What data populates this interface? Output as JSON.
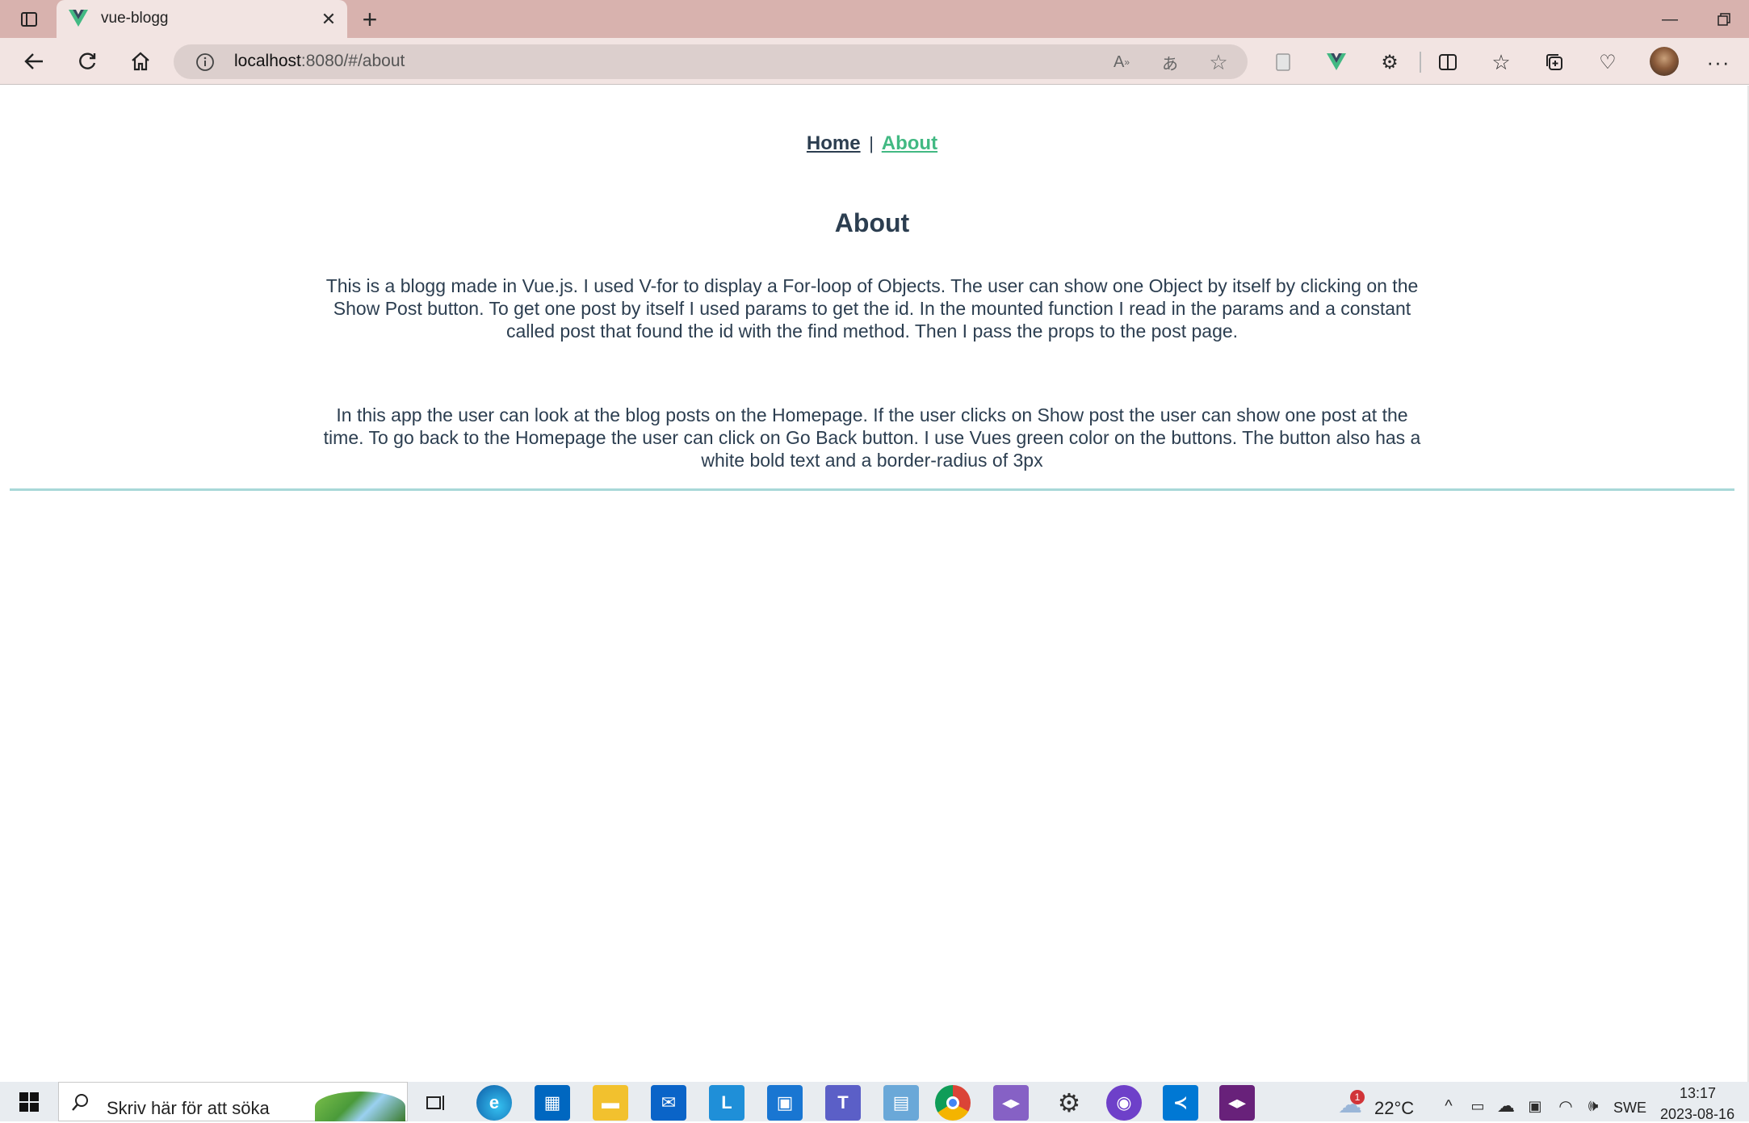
{
  "browser": {
    "tab_title": "vue-blogg",
    "url_host": "localhost",
    "url_path": ":8080/#/about"
  },
  "page": {
    "nav": {
      "home_label": "Home",
      "separator": "|",
      "about_label": "About"
    },
    "heading": "About",
    "paragraph1": "This is a blogg made in Vue.js. I used V-for to display a For-loop of Objects. The user can show one Object by itself by clicking on the Show Post button. To get one post by itself I used params to get the id. In the mounted function I read in the params and a constant called post that found the id with the find method. Then I pass the props to the post page.",
    "paragraph2": "In this app the user can look at the blog posts on the Homepage. If the user clicks on Show post the user can show one post at the time. To go back to the Homepage the user can click on Go Back button. I use Vues green color on the buttons. The button also has a white bold text and a border-radius of 3px"
  },
  "taskbar": {
    "search_placeholder": "Skriv här för att söka",
    "weather_temp": "22°C",
    "weather_badge": "1",
    "language": "SWE",
    "time": "13:17",
    "date": "2023-08-16"
  },
  "colors": {
    "vue_green": "#42b983",
    "text": "#2c3e50",
    "divider": "#a8d8d8"
  }
}
